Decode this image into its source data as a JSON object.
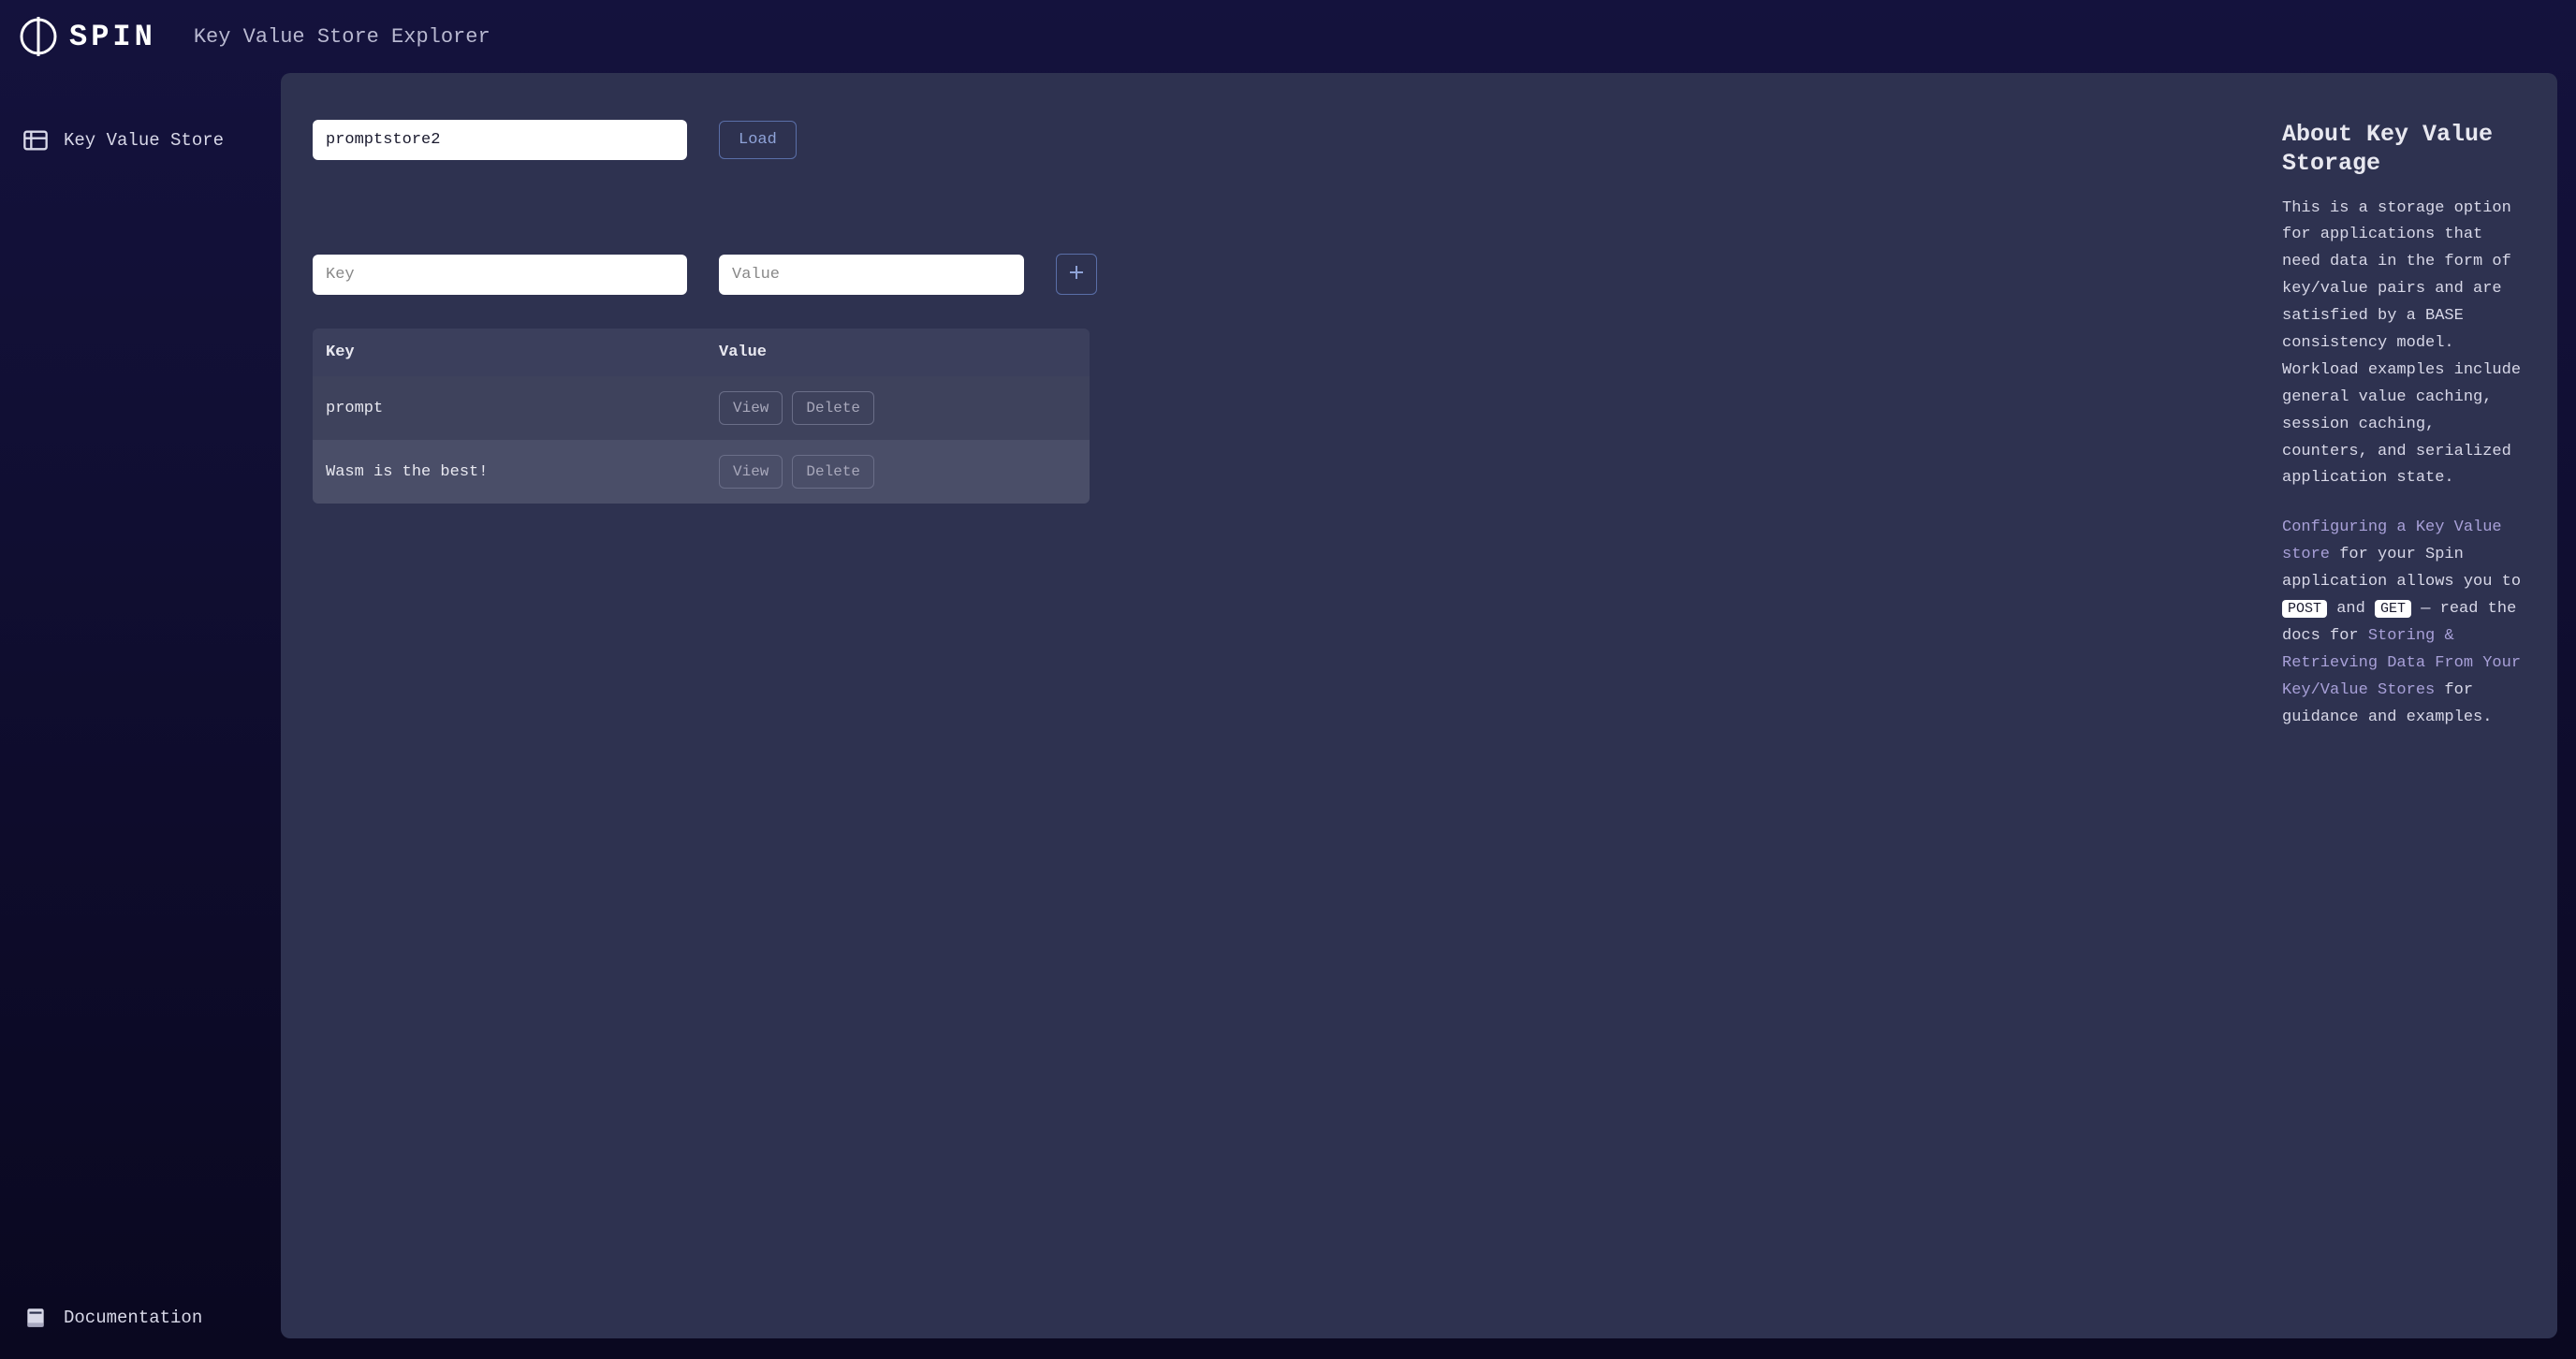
{
  "header": {
    "logo_text": "SPIN",
    "page_title": "Key Value Store Explorer"
  },
  "sidebar": {
    "top_items": [
      {
        "label": "Key Value Store",
        "icon": "table-icon"
      }
    ],
    "bottom_items": [
      {
        "label": "Documentation",
        "icon": "book-icon"
      }
    ]
  },
  "content": {
    "store_input_value": "promptstore2",
    "load_button_label": "Load",
    "key_input_placeholder": "Key",
    "value_input_placeholder": "Value",
    "table": {
      "columns": [
        "Key",
        "Value"
      ],
      "rows": [
        {
          "key": "prompt"
        },
        {
          "key": "Wasm is the best!"
        }
      ]
    },
    "view_label": "View",
    "delete_label": "Delete"
  },
  "about": {
    "title": "About Key Value Storage",
    "para1": "This is a storage option for applications that need data in the form of key/value pairs and are satisfied by a BASE consistency model. Workload examples include general value caching, session caching, counters, and serialized application state.",
    "link1_text": "Configuring a Key Value store",
    "para2_mid1": " for your Spin application allows you to ",
    "post_badge": "POST",
    "and_text": " and ",
    "get_badge": "GET",
    "para2_mid2": " — read the docs for ",
    "link2_text": "Storing & Retrieving Data From Your Key/Value Stores",
    "para2_end": " for guidance and examples."
  }
}
